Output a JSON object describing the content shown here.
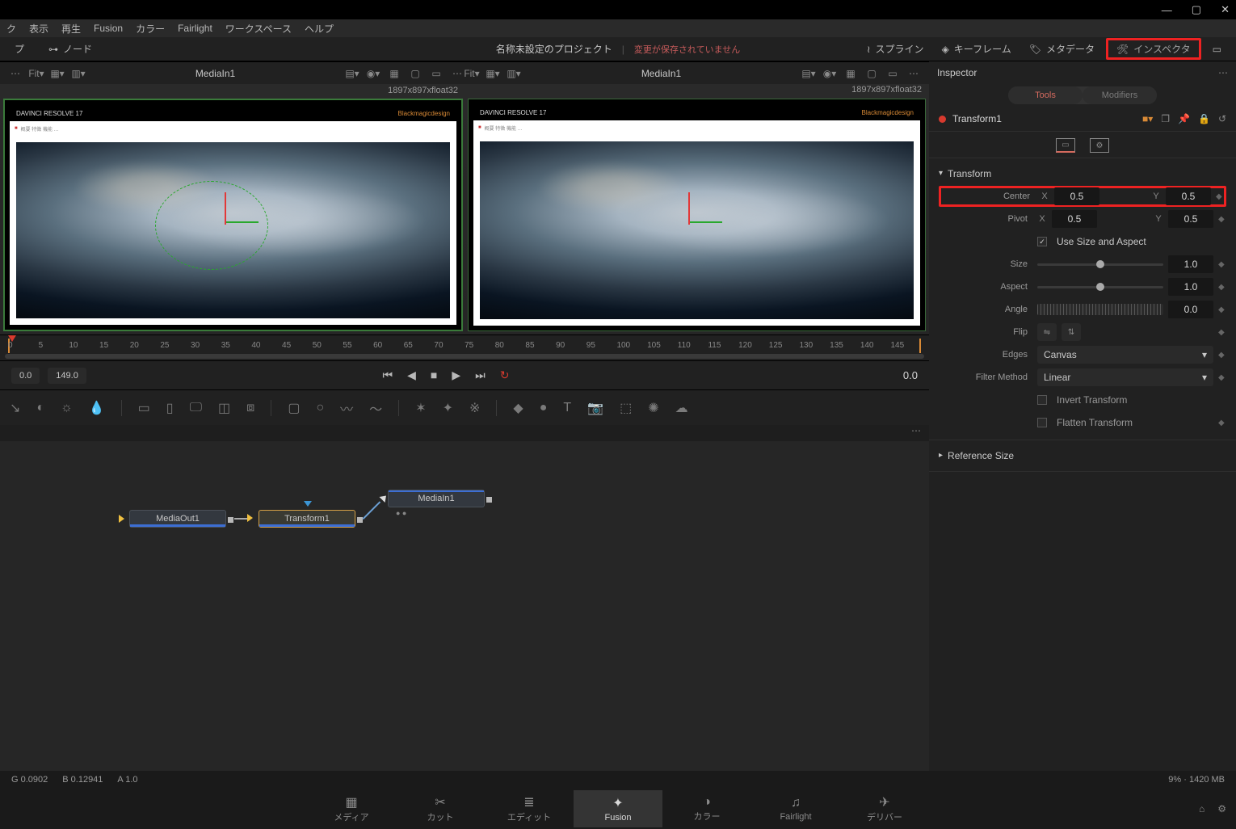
{
  "window": {
    "min": "—",
    "max": "▢",
    "close": "✕"
  },
  "menu": [
    "ク",
    "表示",
    "再生",
    "Fusion",
    "カラー",
    "Fairlight",
    "ワークスペース",
    "ヘルプ"
  ],
  "upper": {
    "clip": "プ",
    "nodes": "ノード",
    "project": "名称未設定のプロジェクト",
    "unsaved": "変更が保存されていません",
    "spline": "スプライン",
    "keyframe": "キーフレーム",
    "metadata": "メタデータ",
    "inspector": "インスペクタ"
  },
  "viewerbar": {
    "fit": "Fit",
    "name1": "MediaIn1",
    "name2": "MediaIn1",
    "res1": "1897x897xfloat32",
    "res2": "1897x897xfloat32"
  },
  "viewer_content": {
    "brand_title": "DAVINCI RESOLVE 17",
    "brand_right": "Blackmagicdesign"
  },
  "ruler_ticks": [
    "0",
    "5",
    "10",
    "15",
    "20",
    "25",
    "30",
    "35",
    "40",
    "45",
    "50",
    "55",
    "60",
    "65",
    "70",
    "75",
    "80",
    "85",
    "90",
    "95",
    "100",
    "105",
    "110",
    "115",
    "120",
    "125",
    "130",
    "135",
    "140",
    "145"
  ],
  "play": {
    "in": "0.0",
    "out": "149.0",
    "time": "0.0"
  },
  "inspector_panel": {
    "title": "Inspector",
    "tabs": {
      "tools": "Tools",
      "modifiers": "Modifiers"
    },
    "node": "Transform1",
    "section_transform": "Transform",
    "section_refsize": "Reference Size",
    "center_label": "Center",
    "center_x": "0.5",
    "center_y": "0.5",
    "pivot_label": "Pivot",
    "pivot_x": "0.5",
    "pivot_y": "0.5",
    "usesize_label": "Use Size and Aspect",
    "size_label": "Size",
    "size_v": "1.0",
    "aspect_label": "Aspect",
    "aspect_v": "1.0",
    "angle_label": "Angle",
    "angle_v": "0.0",
    "flip_label": "Flip",
    "edges_label": "Edges",
    "edges_v": "Canvas",
    "filter_label": "Filter Method",
    "filter_v": "Linear",
    "invert_label": "Invert Transform",
    "flatten_label": "Flatten Transform",
    "x": "X",
    "y": "Y"
  },
  "nodes": {
    "mediaout": "MediaOut1",
    "transform": "Transform1",
    "mediain": "MediaIn1"
  },
  "status": {
    "g": "G  0.0902",
    "b": "B  0.12941",
    "a": "A  1.0",
    "mem": "9% · 1420 MB"
  },
  "pages": {
    "media": "メディア",
    "cut": "カット",
    "edit": "エディット",
    "fusion": "Fusion",
    "color": "カラー",
    "fairlight": "Fairlight",
    "deliver": "デリバー"
  }
}
